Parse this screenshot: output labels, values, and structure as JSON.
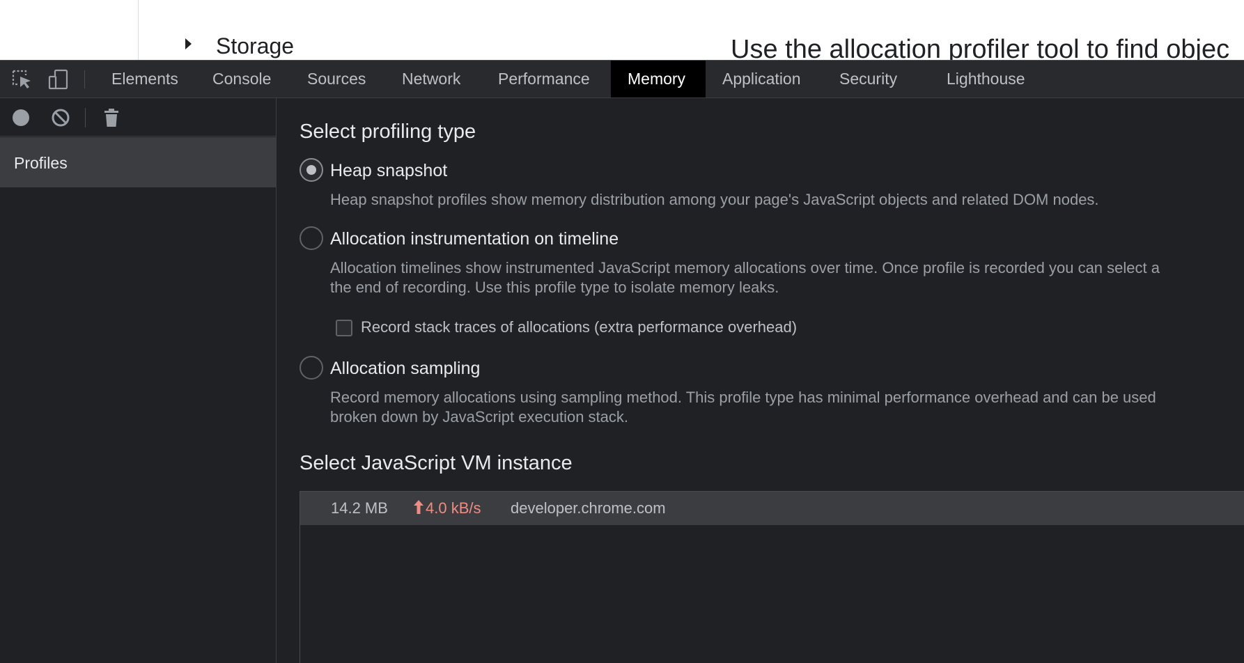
{
  "page": {
    "storage_label": "Storage",
    "heading_fragment": "Use the allocation profiler tool to find objec"
  },
  "toolbar": {
    "inspect_icon": "inspect-element-icon",
    "device_icon": "device-toolbar-icon"
  },
  "tabs": [
    {
      "label": "Elements",
      "active": false
    },
    {
      "label": "Console",
      "active": false
    },
    {
      "label": "Sources",
      "active": false
    },
    {
      "label": "Network",
      "active": false
    },
    {
      "label": "Performance",
      "active": false
    },
    {
      "label": "Memory",
      "active": true
    },
    {
      "label": "Application",
      "active": false
    },
    {
      "label": "Security",
      "active": false
    },
    {
      "label": "Lighthouse",
      "active": false
    }
  ],
  "sidebar": {
    "icons": [
      "record-icon",
      "clear-icon",
      "trash-icon"
    ],
    "profiles_label": "Profiles"
  },
  "profiling": {
    "title": "Select profiling type",
    "options": [
      {
        "label": "Heap snapshot",
        "selected": true,
        "description": [
          "Heap snapshot profiles show memory distribution among your page's JavaScript objects and related DOM nodes."
        ]
      },
      {
        "label": "Allocation instrumentation on timeline",
        "selected": false,
        "description": [
          "Allocation timelines show instrumented JavaScript memory allocations over time. Once profile is recorded you can select a",
          "the end of recording. Use this profile type to isolate memory leaks."
        ]
      },
      {
        "label": "Allocation sampling",
        "selected": false,
        "description": [
          "Record memory allocations using sampling method. This profile type has minimal performance overhead and can be used",
          "broken down by JavaScript execution stack."
        ]
      }
    ],
    "stack_traces_checkbox": {
      "label": "Record stack traces of allocations (extra performance overhead)",
      "checked": false
    }
  },
  "vm": {
    "title": "Select JavaScript VM instance",
    "instances": [
      {
        "size": "14.2 MB",
        "rate": "4.0 kB/s",
        "url": "developer.chrome.com"
      }
    ]
  },
  "colors": {
    "background": "#202124",
    "tabbar": "#292a2d",
    "active_tab": "#000000",
    "rate_red": "#f28b82"
  }
}
